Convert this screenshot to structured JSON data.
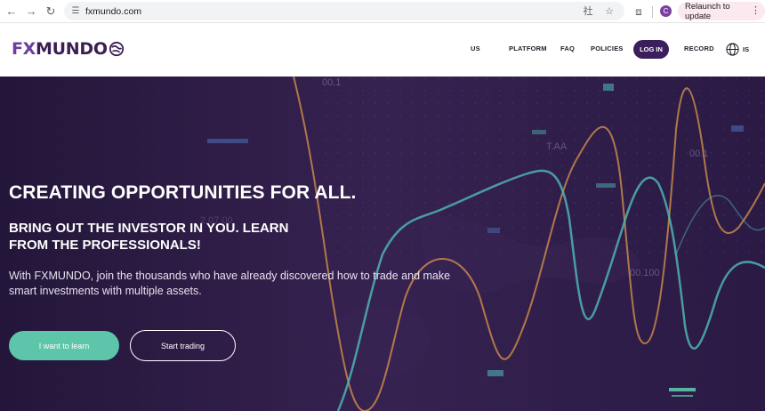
{
  "browser": {
    "url": "fxmundo.com",
    "relaunch_label": "Relaunch to update",
    "profile_initial": "C"
  },
  "site": {
    "logo_fx": "FX",
    "logo_rest": "MUNDO",
    "nav": {
      "us": "US",
      "platform": "PLATFORM",
      "faq": "FAQ",
      "policies": "POLICIES",
      "login": "LOG IN",
      "record": "RECORD",
      "language": "IS"
    }
  },
  "hero": {
    "title": "CREATING OPPORTUNITIES FOR ALL.",
    "subtitle": "BRING OUT THE INVESTOR IN YOU. LEARN FROM THE PROFESSIONALS!",
    "text": "With FXMUNDO, join the thousands who have already discovered how to trade and make smart investments with multiple assets.",
    "btn_learn": "I want to learn",
    "btn_trade": "Start trading",
    "bg_labels": [
      "00.1",
      "T.AA",
      "00.1",
      "00.100",
      "2.07.00"
    ]
  },
  "colors": {
    "accent": "#5cc5aa",
    "brand_dark": "#3a1f5c",
    "hero_bg": "#2b1a40",
    "orange_line": "#c9874a",
    "teal_line": "#4fb3b0"
  }
}
